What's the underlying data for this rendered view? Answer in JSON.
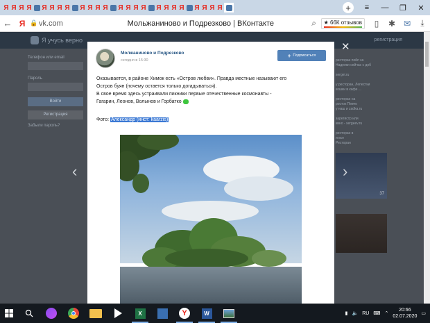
{
  "browser": {
    "tab_glyph": "Я",
    "tab_count": 30,
    "new_tab": "+",
    "window_controls": [
      "≡",
      "—",
      "❐",
      "✕"
    ],
    "address": {
      "back": "←",
      "yandex": "Я",
      "domain": "vk.com",
      "page_title": "Мольжаниново и Подрезково | ВКонтакте",
      "rating": "66К отзывов"
    }
  },
  "vk_background": {
    "logo": "Я учусь верно",
    "register": "регистрация",
    "left": {
      "phone_label": "Телефон или email",
      "password_label": "Пароль",
      "login_btn": "Войти",
      "register_btn": "Регистрация",
      "forgot": "Забыли пароль?"
    },
    "right_lines": [
      "ресторан пейп за",
      "Наделки сейчас с доб",
      "",
      "sergei.ru",
      "",
      "у ресторан, Лепестки",
      "кошки в кафе ...",
      "",
      "ресторан на",
      "росток Певчо",
      "у наш и zadka.ru",
      "",
      "зарегистр или",
      "кино - sergeev.ru",
      "",
      "ресторан в",
      "и все",
      "Ресторан"
    ],
    "img_caption": "37"
  },
  "post": {
    "group_name": "Молжаниново и Подрезково",
    "time": "сегодня в 15:30",
    "subscribe_label": "Подписаться",
    "text_lines": [
      "Оказывается, в районе Химок есть «Остров любви». Правда местные называют его",
      "Остров буян (почему остается только догадываться).",
      "В свое время здесь устраивали пикники первые отечественные космонавты -",
      "Гагарин, Леонов, Волынов и Горбатко"
    ],
    "credit_prefix": "Фото:",
    "credit_selected": "Александр (инст: kaarzis)"
  },
  "taskbar": {
    "lang": "RU",
    "time": "20:66",
    "date": "02.07.2020"
  }
}
